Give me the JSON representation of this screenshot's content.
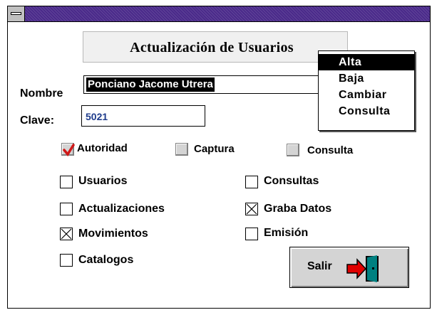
{
  "window": {
    "title": ""
  },
  "header": {
    "title": "Actualización de Usuarios"
  },
  "form": {
    "nombre_label": "Nombre",
    "nombre_value": "Ponciano Jacome Utrera",
    "clave_label": "Clave:",
    "clave_value": "5021"
  },
  "menu": {
    "items": [
      {
        "label": "Alta",
        "selected": true
      },
      {
        "label": "Baja",
        "selected": false
      },
      {
        "label": "Cambiar",
        "selected": false
      },
      {
        "label": "Consulta",
        "selected": false
      }
    ]
  },
  "permissions": {
    "top": [
      {
        "label": "Autoridad",
        "state": "checked"
      },
      {
        "label": "Captura",
        "state": "unchecked"
      },
      {
        "label": "Consulta",
        "state": "unchecked"
      }
    ],
    "left": [
      {
        "label": "Usuarios",
        "state": "unchecked"
      },
      {
        "label": "Actualizaciones",
        "state": "unchecked"
      },
      {
        "label": "Movimientos",
        "state": "crossed"
      },
      {
        "label": "Catalogos",
        "state": "unchecked"
      }
    ],
    "right": [
      {
        "label": "Consultas",
        "state": "unchecked"
      },
      {
        "label": "Graba Datos",
        "state": "crossed"
      },
      {
        "label": "Emisión",
        "state": "unchecked"
      }
    ]
  },
  "buttons": {
    "salir_label": "Salir"
  },
  "icons": {
    "system_menu": "system-menu-icon",
    "exit": "door-exit-icon",
    "check": "red-check-icon"
  },
  "colors": {
    "titlebar": "#4a2a8a",
    "check_red": "#d01818",
    "clave_text": "#1f3c8c",
    "door_teal": "#008080"
  }
}
